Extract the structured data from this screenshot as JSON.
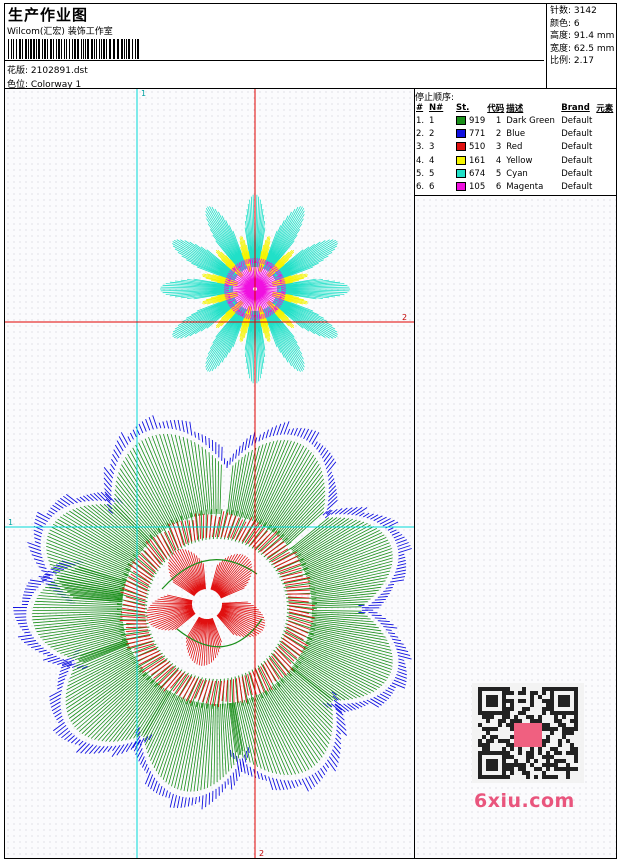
{
  "header": {
    "title": "生产作业图",
    "company": "Wilcom(汇宏) 装饰工作室",
    "design": "花版: 2102891.dst",
    "colorway": "色位: Colorway 1"
  },
  "stats": [
    {
      "label": "针数:",
      "value": "3142"
    },
    {
      "label": "颜色:",
      "value": "6"
    },
    {
      "label": "高度:",
      "value": "91.4 mm"
    },
    {
      "label": "宽度:",
      "value": "62.5 mm"
    },
    {
      "label": "比例:",
      "value": "2.17"
    }
  ],
  "guides": {
    "v1_top": "1",
    "v2_bottom": "2",
    "h1_left": "1",
    "h2_right": "2"
  },
  "sequence": {
    "title": "停止顺序:",
    "headers": [
      "#",
      "N#",
      "St.",
      "代码",
      "描述",
      "Brand",
      "元素"
    ],
    "rows": [
      {
        "n": "1.",
        "nn": "1",
        "color": "#1a8f1a",
        "st": "919",
        "code": "1",
        "desc": "Dark Green",
        "brand": "Default"
      },
      {
        "n": "2.",
        "nn": "2",
        "color": "#1010e0",
        "st": "771",
        "code": "2",
        "desc": "Blue",
        "brand": "Default"
      },
      {
        "n": "3.",
        "nn": "3",
        "color": "#e01010",
        "st": "510",
        "code": "3",
        "desc": "Red",
        "brand": "Default"
      },
      {
        "n": "4.",
        "nn": "4",
        "color": "#f5f500",
        "st": "161",
        "code": "4",
        "desc": "Yellow",
        "brand": "Default"
      },
      {
        "n": "5.",
        "nn": "5",
        "color": "#20e0c8",
        "st": "674",
        "code": "5",
        "desc": "Cyan",
        "brand": "Default"
      },
      {
        "n": "6.",
        "nn": "6",
        "color": "#f010e0",
        "st": "105",
        "code": "6",
        "desc": "Magenta",
        "brand": "Default"
      }
    ]
  },
  "watermark": "6xiu.com",
  "colors": {
    "guide_cyan": "#00d8d8",
    "guide_red": "#e00000",
    "green": "#1a8f1a",
    "blue": "#1010e0",
    "red": "#e01010",
    "yellow": "#f5f500",
    "cyan": "#20e0c8",
    "magenta": "#f010e0"
  }
}
